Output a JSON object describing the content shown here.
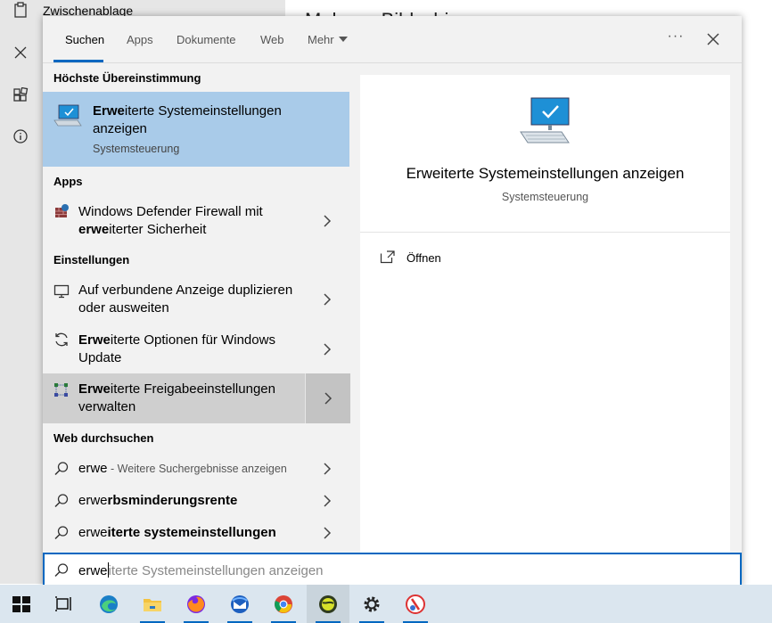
{
  "background_window": {
    "clipboard_label": "Zwischenablage",
    "page_title": "Mehr zu Bildschirm"
  },
  "tabs": [
    {
      "label": "Suchen",
      "active": true
    },
    {
      "label": "Apps"
    },
    {
      "label": "Dokumente"
    },
    {
      "label": "Web"
    },
    {
      "label": "Mehr"
    }
  ],
  "header": {
    "more_options": "···"
  },
  "best_match": {
    "section": "Höchste Übereinstimmung",
    "title_bold": "Erwe",
    "title_rest": "iterte Systemeinstellungen",
    "title_line2": "anzeigen",
    "subtitle": "Systemsteuerung"
  },
  "apps": {
    "section": "Apps",
    "items": [
      {
        "line1": "Windows Defender Firewall mit",
        "bold2": "erwe",
        "rest2": "iterter Sicherheit"
      }
    ]
  },
  "settings": {
    "section": "Einstellungen",
    "items": [
      {
        "line1": "Auf verbundene Anzeige duplizieren",
        "line2": "oder ausweiten"
      },
      {
        "bold1": "Erwe",
        "rest1": "iterte Optionen für Windows",
        "line2": "Update"
      },
      {
        "bold1": "Erwe",
        "rest1": "iterte Freigabeeinstellungen",
        "line2": "verwalten"
      }
    ]
  },
  "web": {
    "section": "Web durchsuchen",
    "items": [
      {
        "plain": "erwe",
        "suffix": " - Weitere Suchergebnisse anzeigen"
      },
      {
        "plain": "erwe",
        "bold": "rbsminderungsrente"
      },
      {
        "plain": "erwe",
        "bold": "iterte systemeinstellungen"
      }
    ]
  },
  "preview": {
    "title": "Erweiterte Systemeinstellungen anzeigen",
    "subtitle": "Systemsteuerung",
    "open_label": "Öffnen"
  },
  "search": {
    "typed": "erwe",
    "ghost": "iterte Systemeinstellungen anzeigen"
  },
  "taskbar": {
    "items": [
      "windows-start",
      "task-view",
      "edge",
      "file-explorer",
      "firefox",
      "thunderbird",
      "chrome",
      "app-globe",
      "settings",
      "paint-app"
    ],
    "accent": "#0067c0"
  }
}
